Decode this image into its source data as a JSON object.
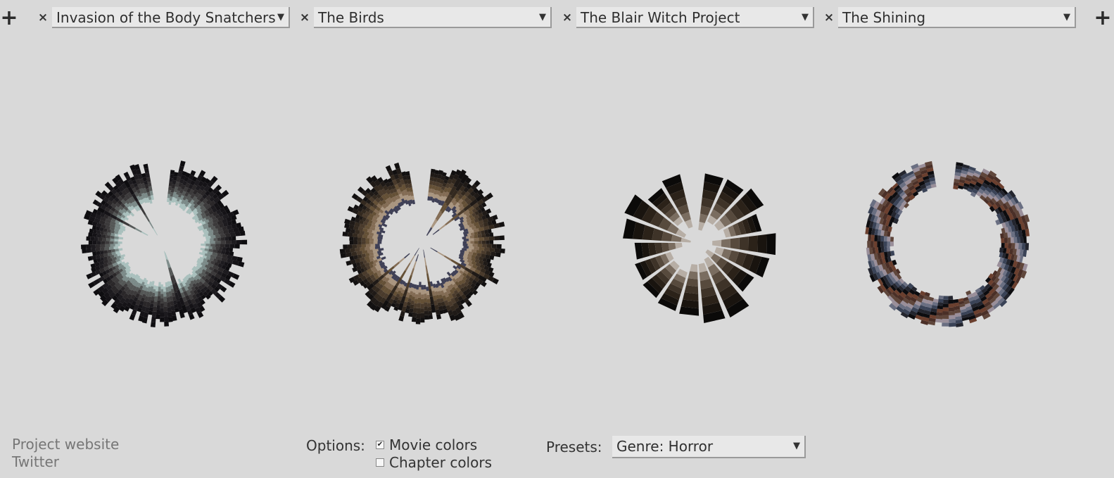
{
  "toolbar": {
    "add_left_label": "+",
    "add_right_label": "+",
    "remove_label": "×",
    "dropdown_arrow": "▼"
  },
  "slots": [
    {
      "title": "Invasion of the Body Snatchers",
      "palette": [
        "#0e0d10",
        "#151317",
        "#1d1b1f",
        "#2a2729",
        "#3c3a3b",
        "#545756",
        "#7b8a88",
        "#a9c0bd"
      ],
      "style": "dark-cold"
    },
    {
      "title": "The Birds",
      "palette": [
        "#121010",
        "#1f1a17",
        "#33291f",
        "#4a3b2c",
        "#645036",
        "#836c54",
        "#a9957f",
        "#3e3f55"
      ],
      "style": "warm-brown"
    },
    {
      "title": "The Blair Witch Project",
      "palette": [
        "#0b0a09",
        "#19140f",
        "#2b2219",
        "#3e3328",
        "#574a3d",
        "#7a6d60",
        "#b7aea5",
        "#f2f0ee"
      ],
      "style": "wedges"
    },
    {
      "title": "The Shining",
      "palette": [
        "#0c0c0f",
        "#23252e",
        "#3a4357",
        "#6a6f82",
        "#9a8f9a",
        "#5f463b",
        "#4a2f27",
        "#6b3f2e"
      ],
      "style": "ring"
    }
  ],
  "footer": {
    "project_website": "Project website",
    "twitter": "Twitter"
  },
  "options": {
    "label": "Options:",
    "movie_colors": {
      "label": "Movie colors",
      "checked": true
    },
    "chapter_colors": {
      "label": "Chapter colors",
      "checked": false
    }
  },
  "presets": {
    "label": "Presets:",
    "selected": "Genre: Horror"
  }
}
